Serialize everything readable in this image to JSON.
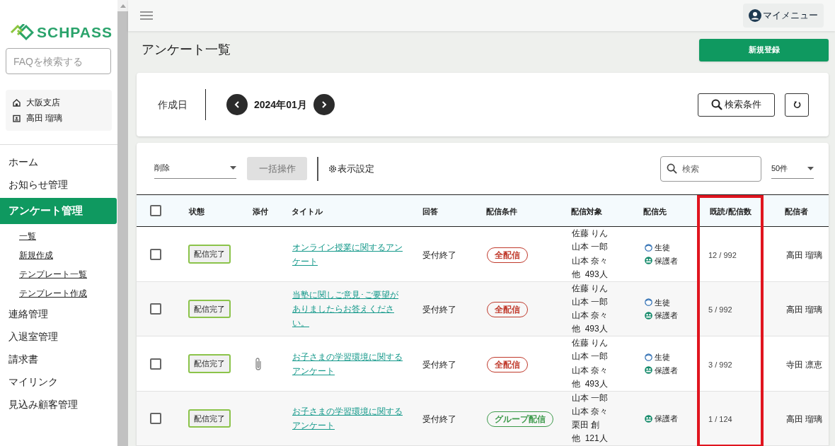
{
  "sidebar": {
    "logo_text": "SCHPASS",
    "faq_search": {
      "placeholder": "FAQを検索する"
    },
    "account": [
      {
        "kind": "branch",
        "text": "大阪支店"
      },
      {
        "kind": "user",
        "text": "高田 瑠璃"
      }
    ],
    "nav": [
      {
        "label": "ホーム",
        "selected": false
      },
      {
        "label": "お知らせ管理",
        "selected": false
      },
      {
        "label": "アンケート管理",
        "selected": true,
        "children": [
          {
            "label": "一覧"
          },
          {
            "label": "新規作成"
          },
          {
            "label": "テンプレート一覧"
          },
          {
            "label": "テンプレート作成"
          }
        ]
      },
      {
        "label": "連絡管理",
        "selected": false
      },
      {
        "label": "入退室管理",
        "selected": false
      },
      {
        "label": "請求書",
        "selected": false
      },
      {
        "label": "マイリンク",
        "selected": false
      },
      {
        "label": "見込み顧客管理",
        "selected": false
      }
    ]
  },
  "header": {
    "my_menu": "マイメニュー"
  },
  "page": {
    "title": "アンケート一覧",
    "new_button": "新規登録"
  },
  "filter": {
    "label": "作成日",
    "month": "2024年01月",
    "search_conditions_button": "検索条件"
  },
  "toolbar": {
    "action_select": "削除",
    "bulk_button": "一括操作",
    "bulk_disabled": true,
    "display_settings": "表示設定",
    "search": {
      "placeholder": "検索"
    },
    "page_size": "50件"
  },
  "table": {
    "columns": [
      {
        "label": "状態",
        "highlighted": false
      },
      {
        "label": "添付",
        "highlighted": false
      },
      {
        "label": "タイトル",
        "highlighted": false
      },
      {
        "label": "回答",
        "highlighted": false
      },
      {
        "label": "配信条件",
        "highlighted": false
      },
      {
        "label": "配信対象",
        "highlighted": false
      },
      {
        "label": "配信先",
        "highlighted": false
      },
      {
        "label": "既読/配信数",
        "highlighted": true
      },
      {
        "label": "配信者",
        "highlighted": false
      }
    ],
    "header_checked": false,
    "rows": [
      {
        "checked": false,
        "status": "配信完了",
        "attachment": false,
        "title": "オンライン授業に関するアンケート",
        "answer": "受付終了",
        "condition": {
          "kind": "all",
          "text": "全配信"
        },
        "targets": [
          "佐藤 りん",
          "山本 一郎",
          "山本 奈々",
          "他  493人"
        ],
        "recipients": [
          {
            "kind": "student",
            "text": "生徒"
          },
          {
            "kind": "guardian",
            "text": "保護者"
          }
        ],
        "read": "12 / 992",
        "sender": "高田 瑠璃"
      },
      {
        "checked": false,
        "status": "配信完了",
        "attachment": false,
        "title": "当塾に関しご意見･ご要望がありましたらお答えください。",
        "answer": "受付終了",
        "condition": {
          "kind": "all",
          "text": "全配信"
        },
        "targets": [
          "佐藤 りん",
          "山本 一郎",
          "山本 奈々",
          "他  493人"
        ],
        "recipients": [
          {
            "kind": "student",
            "text": "生徒"
          },
          {
            "kind": "guardian",
            "text": "保護者"
          }
        ],
        "read": "5 / 992",
        "sender": "高田 瑠璃"
      },
      {
        "checked": false,
        "status": "配信完了",
        "attachment": true,
        "title": "お子さまの学習環境に関するアンケート",
        "answer": "受付終了",
        "condition": {
          "kind": "all",
          "text": "全配信"
        },
        "targets": [
          "佐藤 りん",
          "山本 一郎",
          "山本 奈々",
          "他  493人"
        ],
        "recipients": [
          {
            "kind": "student",
            "text": "生徒"
          },
          {
            "kind": "guardian",
            "text": "保護者"
          }
        ],
        "read": "3 / 992",
        "sender": "寺田 凛恵"
      },
      {
        "checked": false,
        "status": "配信完了",
        "attachment": false,
        "title": "お子さまの学習環境に関するアンケート",
        "answer": "受付終了",
        "condition": {
          "kind": "group",
          "text": "グループ配信"
        },
        "targets": [
          "山本 一郎",
          "山本 奈々",
          "栗田 創",
          "他  121人"
        ],
        "recipients": [
          {
            "kind": "guardian",
            "text": "保護者"
          }
        ],
        "read": "1 / 124",
        "sender": "高田 瑠璃"
      }
    ]
  }
}
